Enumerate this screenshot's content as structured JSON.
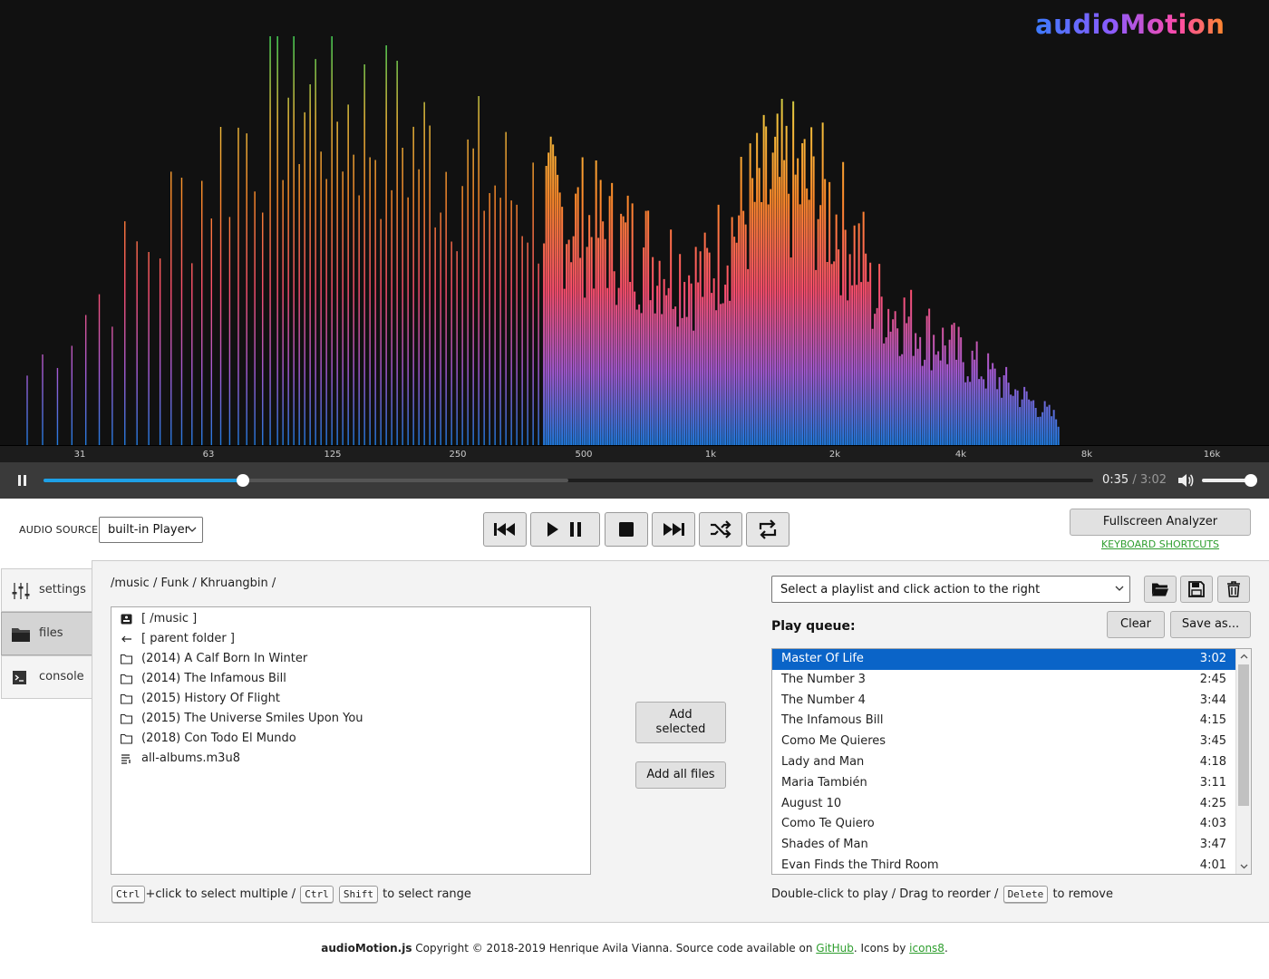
{
  "app": {
    "logo": "audioMotion"
  },
  "analyzer": {
    "scale_labels": [
      "31",
      "63",
      "125",
      "250",
      "500",
      "1k",
      "2k",
      "4k",
      "8k",
      "16k"
    ],
    "gradient_colors": [
      "#1f7be0",
      "#a65bd6",
      "#ff4f6e",
      "#ff8a2a",
      "#f2c23c",
      "#4ade5a"
    ]
  },
  "player": {
    "progress": 0.19,
    "buffered": 0.5,
    "current_time": "0:35",
    "separator": "/",
    "duration": "3:02",
    "volume": 1.0
  },
  "audio_source": {
    "label": "AUDIO SOURCE:",
    "value": "built-in Player"
  },
  "transport": {
    "icons": [
      "skip-previous-icon",
      "play-pause-icon",
      "stop-icon",
      "skip-next-icon",
      "shuffle-icon",
      "repeat-icon"
    ]
  },
  "top_right": {
    "fullscreen_label": "Fullscreen Analyzer",
    "keyboard_shortcuts": "KEYBOARD SHORTCUTS"
  },
  "tabs": [
    {
      "label": "settings",
      "icon": "sliders-icon",
      "active": false
    },
    {
      "label": "files",
      "icon": "folder-icon",
      "active": true
    },
    {
      "label": "console",
      "icon": "terminal-icon",
      "active": false
    }
  ],
  "files": {
    "breadcrumb": "/music / Funk / Khruangbin /",
    "items": [
      {
        "label": "[ /music ]",
        "icon": "drive-icon"
      },
      {
        "label": "[ parent folder ]",
        "icon": "arrow-left-icon"
      },
      {
        "label": "(2014) A Calf Born In Winter",
        "icon": "folder-icon"
      },
      {
        "label": "(2014) The Infamous Bill",
        "icon": "folder-icon"
      },
      {
        "label": "(2015) History Of Flight",
        "icon": "folder-icon"
      },
      {
        "label": "(2015) The Universe Smiles Upon You",
        "icon": "folder-icon"
      },
      {
        "label": "(2018) Con Todo El Mundo",
        "icon": "folder-icon"
      },
      {
        "label": "all-albums.m3u8",
        "icon": "playlist-file-icon"
      }
    ],
    "hint": {
      "key1": "Ctrl",
      "text1": "+click to select multiple /",
      "key2": "Ctrl",
      "key3": "Shift",
      "text2": "to select range"
    }
  },
  "actions": {
    "add_selected": "Add selected",
    "add_all": "Add all files"
  },
  "queue": {
    "playlist_placeholder": "Select a playlist and click action to the right",
    "title": "Play queue:",
    "clear_label": "Clear",
    "save_as_label": "Save as...",
    "items": [
      {
        "title": "Master Of Life",
        "duration": "3:02",
        "selected": true
      },
      {
        "title": "The Number 3",
        "duration": "2:45"
      },
      {
        "title": "The Number 4",
        "duration": "3:44"
      },
      {
        "title": "The Infamous Bill",
        "duration": "4:15"
      },
      {
        "title": "Como Me Quieres",
        "duration": "3:45"
      },
      {
        "title": "Lady and Man",
        "duration": "4:18"
      },
      {
        "title": "Maria También",
        "duration": "3:11"
      },
      {
        "title": "August 10",
        "duration": "4:25"
      },
      {
        "title": "Como Te Quiero",
        "duration": "4:03"
      },
      {
        "title": "Shades of Man",
        "duration": "3:47"
      },
      {
        "title": "Evan Finds the Third Room",
        "duration": "4:01"
      }
    ],
    "hint": {
      "text1": "Double-click to play / Drag to reorder /",
      "key": "Delete",
      "text2": "to remove"
    }
  },
  "footer": {
    "brand": "audioMotion.js",
    "text1": " Copyright © 2018-2019 Henrique Avila Vianna. Source code available on ",
    "github": "GitHub",
    "text2": ". Icons by ",
    "icons8": "icons8",
    "text3": "."
  }
}
